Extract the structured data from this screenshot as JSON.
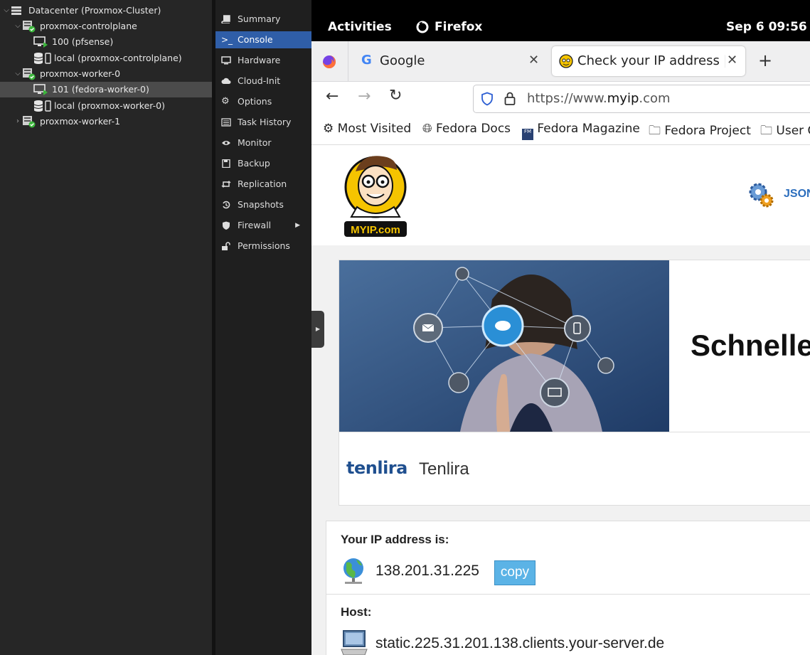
{
  "tree": {
    "items": [
      {
        "label": "Datacenter (Proxmox-Cluster)"
      },
      {
        "label": "proxmox-controlplane"
      },
      {
        "label": "100 (pfsense)"
      },
      {
        "label": "local (proxmox-controlplane)"
      },
      {
        "label": "proxmox-worker-0"
      },
      {
        "label": "101 (fedora-worker-0)"
      },
      {
        "label": "local (proxmox-worker-0)"
      },
      {
        "label": "proxmox-worker-1"
      }
    ],
    "selected": "101 (fedora-worker-0)"
  },
  "nav": {
    "items": [
      {
        "label": "Summary",
        "icon": "book-icon"
      },
      {
        "label": "Console",
        "icon": "terminal-icon"
      },
      {
        "label": "Hardware",
        "icon": "monitor-icon"
      },
      {
        "label": "Cloud-Init",
        "icon": "cloud-icon"
      },
      {
        "label": "Options",
        "icon": "gear-icon"
      },
      {
        "label": "Task History",
        "icon": "list-icon"
      },
      {
        "label": "Monitor",
        "icon": "eye-icon"
      },
      {
        "label": "Backup",
        "icon": "floppy-icon"
      },
      {
        "label": "Replication",
        "icon": "retweet-icon"
      },
      {
        "label": "Snapshots",
        "icon": "history-icon"
      },
      {
        "label": "Firewall",
        "icon": "shield-icon"
      },
      {
        "label": "Permissions",
        "icon": "unlock-icon"
      }
    ],
    "active": "Console"
  },
  "gnome": {
    "activities": "Activities",
    "app": "Firefox",
    "clock": "Sep 6  09:56"
  },
  "browser": {
    "tabs": [
      {
        "title": "Google"
      },
      {
        "title": "Check your IP address | My"
      }
    ],
    "url_prefix": "https://www.",
    "url_domain": "myip",
    "url_suffix": ".com",
    "bookmarks": [
      "Most Visited",
      "Fedora Docs",
      "Fedora Magazine",
      "Fedora Project",
      "User C"
    ]
  },
  "site": {
    "logo_text": "MYIP.com",
    "json_link": "JSON",
    "ad_headline": "Schnelle",
    "ad_brand_logo": "tenlira",
    "ad_brand_name": "Tenlira",
    "ip_label": "Your IP address is:",
    "ip_value": "138.201.31.225",
    "copy_label": "copy",
    "host_label": "Host:",
    "host_value": "static.225.31.201.138.clients.your-server.de"
  },
  "colors": {
    "proxmox_bg": "#262626",
    "nav_active": "#2f5ea8",
    "status_green": "#3cb63c",
    "copy_button": "#5bb3e6"
  }
}
